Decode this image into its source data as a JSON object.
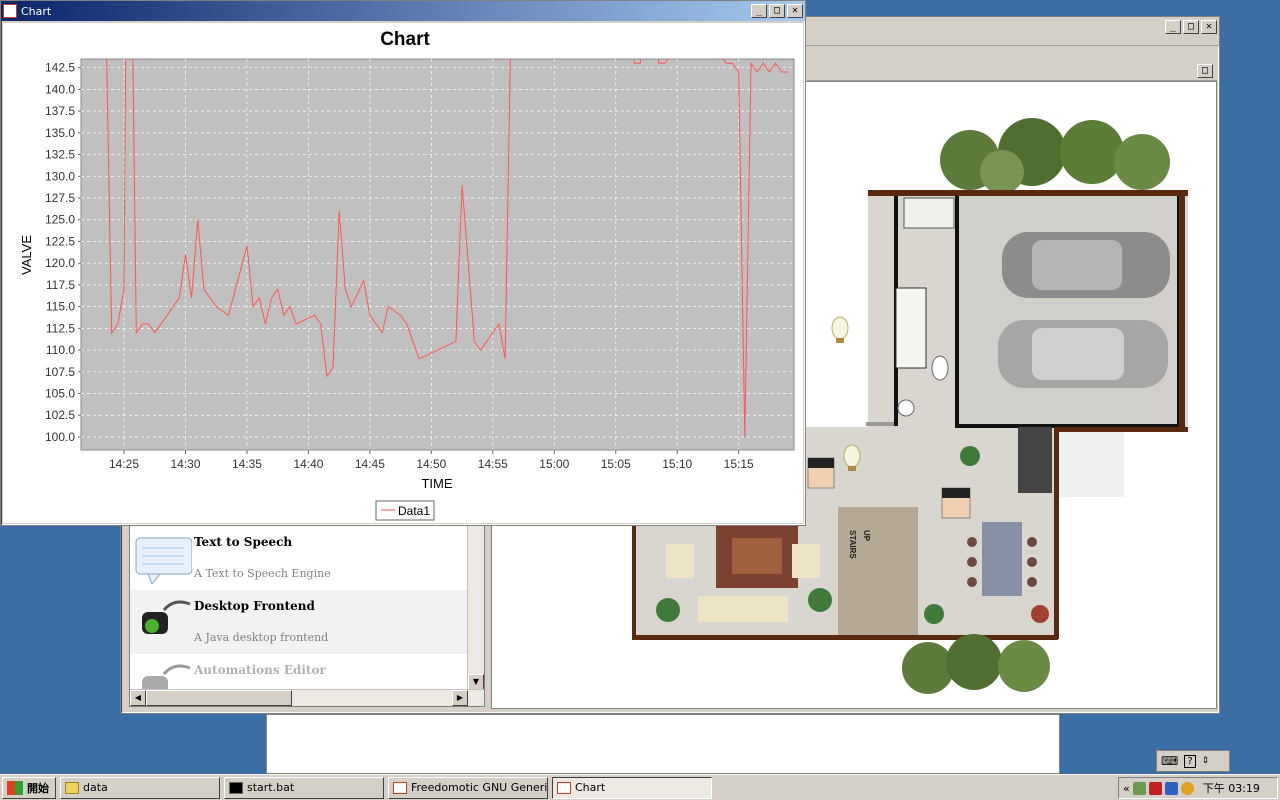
{
  "main_window": {
    "minimize": "_",
    "maximize": "□",
    "close": "✕"
  },
  "plugins": [
    {
      "name": "Text to Speech",
      "description": "A Text to Speech Engine"
    },
    {
      "name": "Desktop Frontend",
      "description": "A Java desktop frontend"
    },
    {
      "name": "Automations Editor",
      "description": ""
    }
  ],
  "floorplan": {
    "stairs_label": "STAIRS",
    "up_label": "UP"
  },
  "chart_window": {
    "title": "Chart",
    "minimize": "_",
    "maximize": "□",
    "close": "✕"
  },
  "chart_data": {
    "type": "line",
    "title": "Chart",
    "xlabel": "TIME",
    "ylabel": "VALVE",
    "legend": "Data1",
    "legend_position": "bottom",
    "series_color": "#ff5555",
    "plot_bg": "#c0c0c0",
    "ylim": [
      98.5,
      143.5
    ],
    "yticks": [
      "100.0",
      "102.5",
      "105.0",
      "107.5",
      "110.0",
      "112.5",
      "115.0",
      "117.5",
      "120.0",
      "122.5",
      "125.0",
      "127.5",
      "130.0",
      "132.5",
      "135.0",
      "137.5",
      "140.0",
      "142.5"
    ],
    "xlim": [
      "14:21:30",
      "15:19:30"
    ],
    "xticks": [
      "14:25",
      "14:30",
      "14:35",
      "14:40",
      "14:45",
      "14:50",
      "14:55",
      "15:00",
      "15:05",
      "15:10",
      "15:15"
    ],
    "series": [
      {
        "name": "Data1",
        "points": [
          [
            "14:23:30",
            150
          ],
          [
            "14:24:00",
            112
          ],
          [
            "14:24:30",
            113
          ],
          [
            "14:25:00",
            117
          ],
          [
            "14:25:10",
            150
          ],
          [
            "14:25:40",
            150
          ],
          [
            "14:26:00",
            112
          ],
          [
            "14:26:30",
            113
          ],
          [
            "14:27:00",
            113
          ],
          [
            "14:27:30",
            112
          ],
          [
            "14:28:30",
            114
          ],
          [
            "14:29:30",
            116
          ],
          [
            "14:30:00",
            121
          ],
          [
            "14:30:30",
            116
          ],
          [
            "14:31:00",
            125
          ],
          [
            "14:31:30",
            117
          ],
          [
            "14:32:30",
            115
          ],
          [
            "14:33:30",
            114
          ],
          [
            "14:35:00",
            122
          ],
          [
            "14:35:30",
            115
          ],
          [
            "14:36:00",
            116
          ],
          [
            "14:36:30",
            113
          ],
          [
            "14:37:00",
            116
          ],
          [
            "14:37:30",
            117
          ],
          [
            "14:38:00",
            114
          ],
          [
            "14:38:30",
            115
          ],
          [
            "14:39:00",
            113
          ],
          [
            "14:40:30",
            114
          ],
          [
            "14:41:00",
            113
          ],
          [
            "14:41:30",
            107
          ],
          [
            "14:42:00",
            108
          ],
          [
            "14:42:30",
            126
          ],
          [
            "14:43:00",
            117
          ],
          [
            "14:43:30",
            115
          ],
          [
            "14:44:30",
            118
          ],
          [
            "14:45:00",
            114
          ],
          [
            "14:46:00",
            112
          ],
          [
            "14:46:30",
            115
          ],
          [
            "14:47:30",
            114
          ],
          [
            "14:48:00",
            113
          ],
          [
            "14:49:00",
            109
          ],
          [
            "14:52:00",
            111
          ],
          [
            "14:52:30",
            129
          ],
          [
            "14:53:30",
            111
          ],
          [
            "14:54:00",
            110
          ],
          [
            "14:55:30",
            113
          ],
          [
            "14:56:00",
            109
          ],
          [
            "14:56:30",
            150
          ],
          [
            "15:06:00",
            150
          ],
          [
            "15:06:30",
            143
          ],
          [
            "15:07:00",
            143
          ],
          [
            "15:07:30",
            150
          ],
          [
            "15:08:00",
            150
          ],
          [
            "15:08:30",
            143
          ],
          [
            "15:09:00",
            143
          ],
          [
            "15:09:30",
            144
          ],
          [
            "15:10:00",
            150
          ],
          [
            "15:14:00",
            143
          ],
          [
            "15:14:30",
            143
          ],
          [
            "15:15:00",
            142
          ],
          [
            "15:15:30",
            100
          ],
          [
            "15:16:00",
            143
          ],
          [
            "15:16:30",
            142
          ],
          [
            "15:17:00",
            143
          ],
          [
            "15:17:30",
            142
          ],
          [
            "15:18:00",
            143
          ],
          [
            "15:18:30",
            142
          ],
          [
            "15:19:00",
            142
          ]
        ]
      }
    ]
  },
  "taskbar": {
    "start": "開始",
    "tasks": [
      "data",
      "start.bat",
      "Freedomotic GNU Generi...",
      "Chart"
    ],
    "clock": "下午 03:19",
    "tray_chevron": "«"
  }
}
